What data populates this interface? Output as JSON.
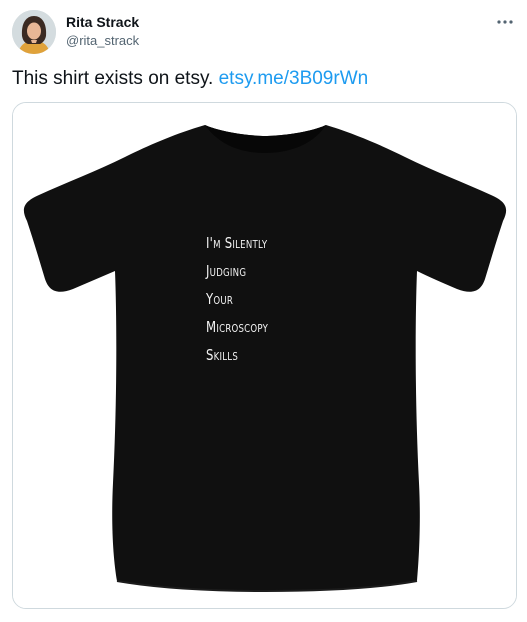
{
  "author": {
    "name": "Rita Strack",
    "handle": "@rita_strack"
  },
  "tweet": {
    "text": "This shirt exists on etsy.",
    "link": "etsy.me/3B09rWn"
  },
  "media": {
    "shirt_lines": [
      "I'm Silently",
      "Judging",
      "Your",
      "Microscopy",
      "Skills"
    ]
  },
  "icons": {
    "more": "more-horizontal-icon"
  }
}
